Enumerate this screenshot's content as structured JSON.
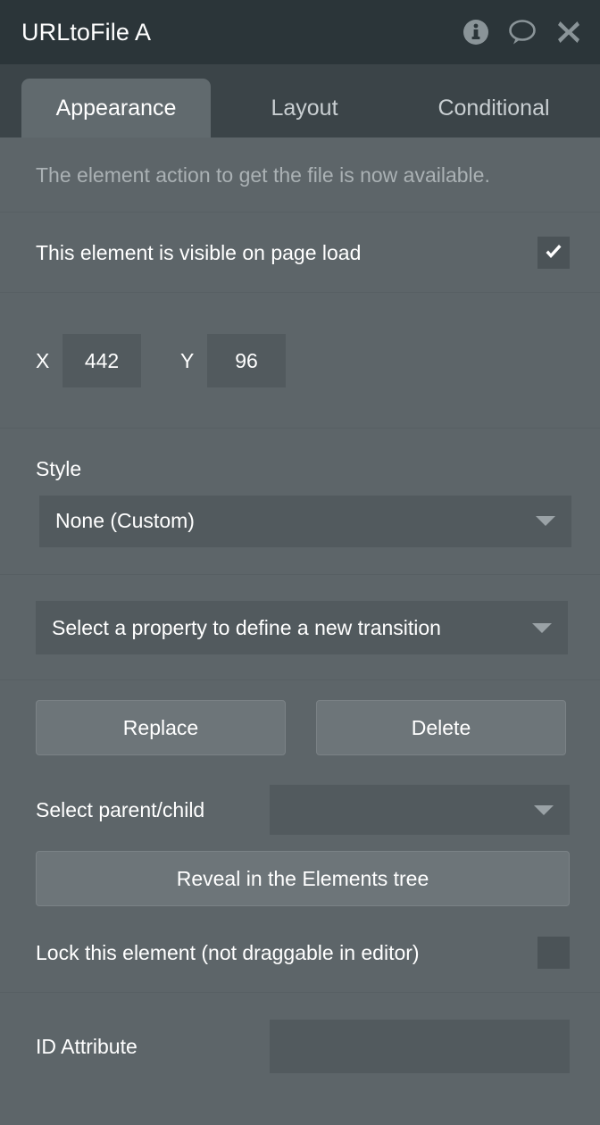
{
  "titlebar": {
    "title": "URLtoFile A",
    "icons": [
      {
        "name": "info-icon"
      },
      {
        "name": "comment-icon"
      },
      {
        "name": "close-icon"
      }
    ]
  },
  "tabs": [
    {
      "label": "Appearance",
      "active": true
    },
    {
      "label": "Layout",
      "active": false
    },
    {
      "label": "Conditional",
      "active": false
    }
  ],
  "appearance": {
    "note": "The element action to get the file is now available.",
    "visible_on_page_load": {
      "label": "This element is visible on page load",
      "checked": true
    },
    "position": {
      "x_label": "X",
      "x_value": "442",
      "y_label": "Y",
      "y_value": "96"
    },
    "style": {
      "label": "Style",
      "value": "None (Custom)"
    },
    "transition": {
      "value": "Select a property to define a new transition"
    },
    "actions": {
      "replace_label": "Replace",
      "delete_label": "Delete"
    },
    "parent_child": {
      "label": "Select parent/child",
      "value": ""
    },
    "reveal_label": "Reveal in the Elements tree",
    "lock": {
      "label": "Lock this element (not draggable in editor)",
      "checked": false
    },
    "id_attribute": {
      "label": "ID Attribute",
      "value": ""
    }
  },
  "colors": {
    "titlebar_bg": "#2b3539",
    "tabbar_bg": "#3b4448",
    "panel_bg": "#5d6569",
    "active_tab_bg": "#616a6e",
    "input_bg": "#525a5e",
    "button_bg": "#6d7579",
    "icon_gray": "#8a9498",
    "muted_text": "#aab1b4"
  }
}
